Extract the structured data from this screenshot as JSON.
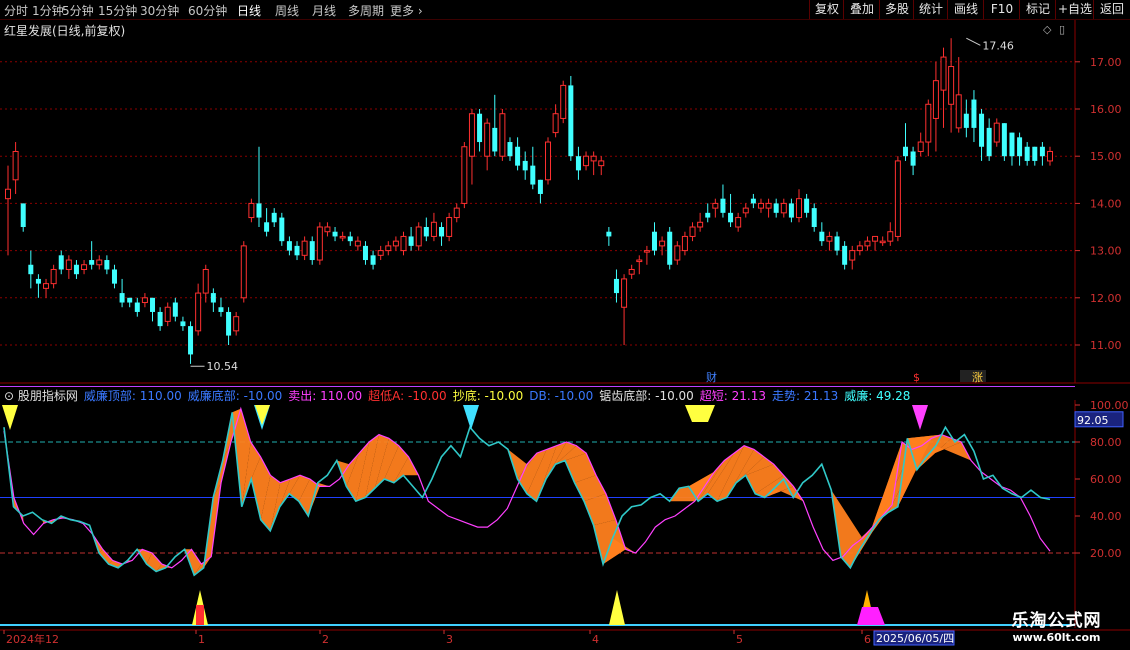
{
  "toolbar": {
    "left_items": [
      "分时",
      "1分钟",
      "5分钟",
      "15分钟",
      "30分钟",
      "60分钟",
      "日线",
      "周线",
      "月线",
      "多周期",
      "更多"
    ],
    "active": "日线",
    "right_items": [
      "复权",
      "叠加",
      "多股",
      "统计",
      "画线",
      "F10",
      "标记",
      "+自选",
      "返回"
    ]
  },
  "main_chart": {
    "title": "红星发展(日线,前复权)",
    "high_label": "17.46",
    "low_label": "10.54",
    "y_ticks": [
      "17.00",
      "16.00",
      "15.00",
      "14.00",
      "13.00",
      "12.00",
      "11.00"
    ],
    "markers": [
      "财",
      "$",
      "涨"
    ]
  },
  "indicator": {
    "name": "股朋指标网",
    "legend": [
      {
        "label": "威廉顶部: 110.00",
        "color": "#3a78ff"
      },
      {
        "label": "威廉底部: -10.00",
        "color": "#3a78ff"
      },
      {
        "label": "卖出: 110.00",
        "color": "#ff40ff"
      },
      {
        "label": "超低A: -10.00",
        "color": "#ff3030"
      },
      {
        "label": "抄底: -10.00",
        "color": "#ffff40"
      },
      {
        "label": "DB: -10.00",
        "color": "#3a78ff"
      },
      {
        "label": "锯齿底部: -10.00",
        "color": "#e0e0e0"
      },
      {
        "label": "超短: 21.13",
        "color": "#ff40ff"
      },
      {
        "label": "走势: 21.13",
        "color": "#3a78ff"
      },
      {
        "label": "威廉: 49.28",
        "color": "#40ffff"
      }
    ],
    "y_ticks": [
      "100.00",
      "80.00",
      "60.00",
      "40.00",
      "20.00"
    ],
    "current_value": "92.05"
  },
  "x_axis": {
    "labels": [
      "2024年12",
      "1",
      "2",
      "3",
      "4",
      "5",
      "6"
    ],
    "cursor_date": "2025/06/05/四"
  },
  "watermark": {
    "line1": "乐淘公式网",
    "line2": "www.60lt.com"
  },
  "colors": {
    "up": "#ff3030",
    "down": "#40ffff",
    "grid": "#8b0000",
    "orange": "#ff7f1e"
  }
}
